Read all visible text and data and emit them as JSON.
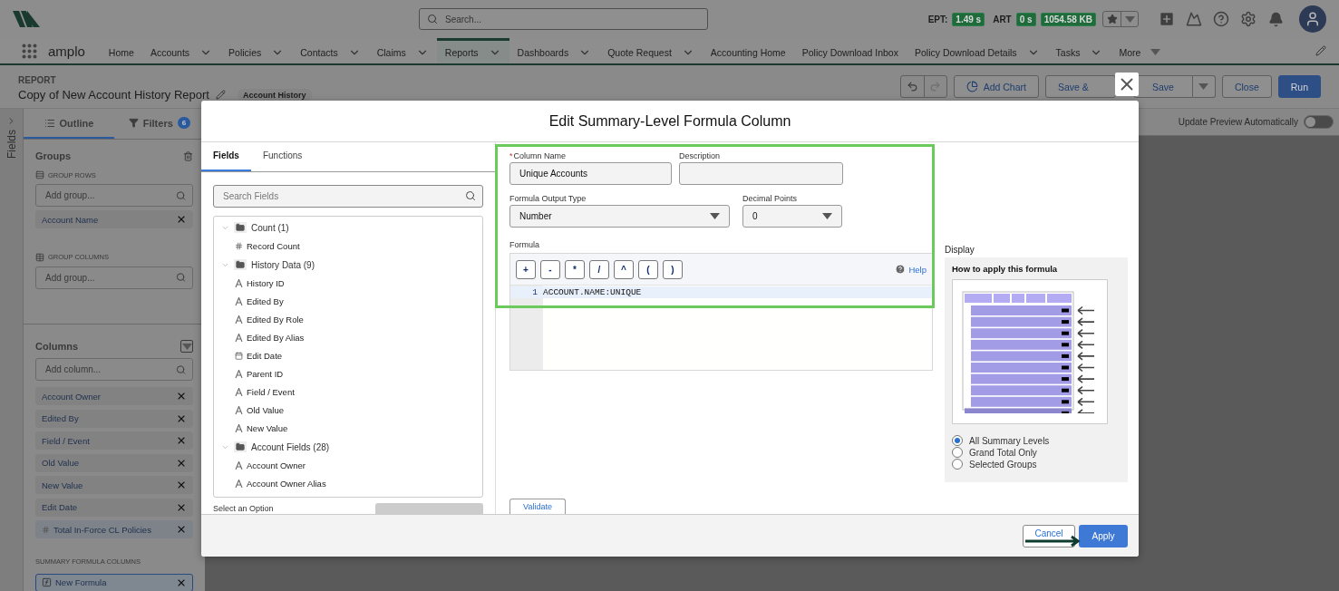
{
  "header": {
    "search_placeholder": "Search...",
    "metrics": [
      {
        "label": "EPT:",
        "value": "1.49 s"
      },
      {
        "label": "ART",
        "value": "0 s"
      },
      {
        "value": "1054.58 KB"
      }
    ]
  },
  "nav": {
    "app_name": "amplo",
    "items": [
      {
        "label": "Home",
        "dropdown": false,
        "selected": false
      },
      {
        "label": "Accounts",
        "dropdown": true,
        "selected": false
      },
      {
        "label": "Policies",
        "dropdown": true,
        "selected": false
      },
      {
        "label": "Contacts",
        "dropdown": true,
        "selected": false
      },
      {
        "label": "Claims",
        "dropdown": true,
        "selected": false
      },
      {
        "label": "Reports",
        "dropdown": true,
        "selected": true
      },
      {
        "label": "Dashboards",
        "dropdown": true,
        "selected": false
      },
      {
        "label": "Quote Request",
        "dropdown": true,
        "selected": false
      },
      {
        "label": "Accounting Home",
        "dropdown": false,
        "selected": false
      },
      {
        "label": "Policy Download Inbox",
        "dropdown": false,
        "selected": false
      },
      {
        "label": "Policy Download Details",
        "dropdown": true,
        "selected": false
      },
      {
        "label": "Tasks",
        "dropdown": true,
        "selected": false
      },
      {
        "label": "More",
        "dropdown": true,
        "kind": "overflow",
        "selected": false
      }
    ]
  },
  "report": {
    "eyebrow": "REPORT",
    "title": "Copy of New Account History Report",
    "badge": "Account History",
    "buttons": [
      {
        "label": "Add Chart",
        "kind": "chart"
      },
      {
        "label": "Save &",
        "kind": "plain"
      },
      {
        "label": "Save",
        "kind": "split"
      },
      {
        "label": "Close",
        "kind": "plain"
      },
      {
        "label": "Run",
        "kind": "primary"
      }
    ]
  },
  "sidebar": {
    "fields_tab": "Fields",
    "tabs": [
      {
        "label": "Outline",
        "selected": true
      },
      {
        "label": "Filters",
        "selected": false,
        "count": "6"
      }
    ],
    "groups": {
      "title": "Groups",
      "rows_label": "GROUP ROWS",
      "rows_placeholder": "Add group...",
      "rows": [
        {
          "label": "Account Name"
        }
      ],
      "columns_label": "GROUP COLUMNS",
      "columns_placeholder": "Add group..."
    },
    "columns": {
      "title": "Columns",
      "placeholder": "Add column...",
      "items": [
        {
          "label": "Account Owner"
        },
        {
          "label": "Edited By"
        },
        {
          "label": "Field / Event"
        },
        {
          "label": "Old Value"
        },
        {
          "label": "New Value"
        },
        {
          "label": "Edit Date"
        },
        {
          "label": "Total In-Force CL Policies",
          "kind": "number"
        }
      ]
    },
    "summary_formulas": {
      "title": "SUMMARY FORMULA COLUMNS",
      "items": [
        {
          "label": "New Formula",
          "kind": "formula",
          "selected": true
        }
      ]
    }
  },
  "preview": {
    "auto_update_label": "Update Preview Automatically",
    "on": false
  },
  "modal": {
    "title": "Edit Summary-Level Formula Column",
    "tabs": [
      {
        "label": "Fields",
        "selected": true
      },
      {
        "label": "Functions",
        "selected": false
      }
    ],
    "search_placeholder": "Search Fields",
    "tree": [
      {
        "label": "Count (1)",
        "expanded": true,
        "children": [
          {
            "label": "Record Count",
            "kind": "number"
          }
        ]
      },
      {
        "label": "History Data (9)",
        "expanded": true,
        "children": [
          {
            "label": "History ID",
            "kind": "text"
          },
          {
            "label": "Edited By",
            "kind": "text"
          },
          {
            "label": "Edited By Role",
            "kind": "text"
          },
          {
            "label": "Edited By Alias",
            "kind": "text"
          },
          {
            "label": "Edit Date",
            "kind": "date"
          },
          {
            "label": "Parent ID",
            "kind": "text"
          },
          {
            "label": "Field / Event",
            "kind": "text"
          },
          {
            "label": "Old Value",
            "kind": "text"
          },
          {
            "label": "New Value",
            "kind": "text"
          }
        ]
      },
      {
        "label": "Account Fields (28)",
        "expanded": true,
        "children": [
          {
            "label": "Account Owner",
            "kind": "text"
          },
          {
            "label": "Account Owner Alias",
            "kind": "text"
          }
        ]
      }
    ],
    "select_label": "Select an Option",
    "form": {
      "column_name": {
        "label": "Column Name",
        "required_mark": "*",
        "value": "Unique Accounts"
      },
      "description": {
        "label": "Description"
      },
      "output_type": {
        "label": "Formula Output Type",
        "value": "Number"
      },
      "decimal_points": {
        "label": "Decimal Points",
        "value": "0"
      },
      "formula": {
        "label": "Formula",
        "operators": [
          "+",
          "-",
          "*",
          "/",
          "^",
          "(",
          ")"
        ],
        "help": "Help",
        "lines": [
          {
            "number": "1",
            "code": "ACCOUNT.NAME:UNIQUE"
          }
        ]
      },
      "validate": "Validate"
    },
    "display": {
      "label": "Display",
      "heading": "How to apply this formula",
      "options": [
        {
          "label": "All Summary Levels",
          "selected": true
        },
        {
          "label": "Grand Total Only",
          "selected": false
        },
        {
          "label": "Selected Groups",
          "selected": false
        }
      ]
    },
    "footer": {
      "cancel": "Cancel",
      "apply": "Apply"
    }
  }
}
